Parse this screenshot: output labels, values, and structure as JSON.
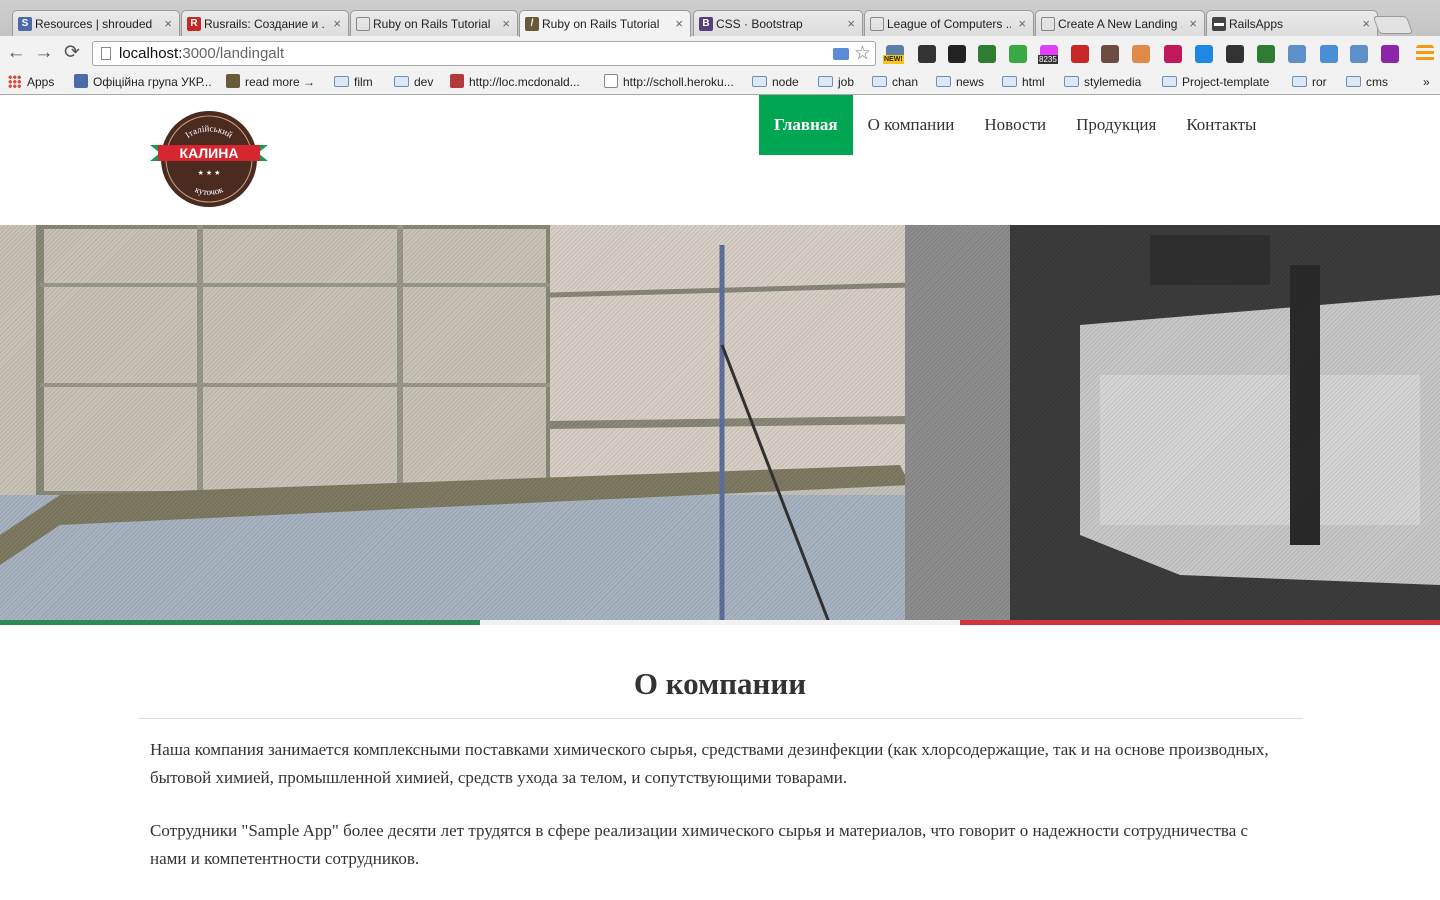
{
  "browser": {
    "tabs": [
      {
        "label": "Resources | shrouded",
        "fav_color": "#4a6aa8",
        "fav_char": "S"
      },
      {
        "label": "Rusrails: Создание и ...",
        "fav_color": "#c62828",
        "fav_char": "R"
      },
      {
        "label": "Ruby on Rails Tutorial",
        "fav_color": "#ffffff",
        "fav_char": ""
      },
      {
        "label": "Ruby on Rails Tutorial",
        "fav_color": "#6b5a3a",
        "fav_char": "/"
      },
      {
        "label": "CSS · Bootstrap",
        "fav_color": "#563d7c",
        "fav_char": "B"
      },
      {
        "label": "League of Computers ...",
        "fav_color": "#ffffff",
        "fav_char": ""
      },
      {
        "label": "Create A New Landing ...",
        "fav_color": "#ffffff",
        "fav_char": ""
      },
      {
        "label": "RailsApps",
        "fav_color": "#444444",
        "fav_char": "▬"
      }
    ],
    "close_glyph": "×",
    "address": {
      "host": "localhost:",
      "path": "3000/landingalt"
    },
    "nav_icons": {
      "back": "←",
      "forward": "→",
      "reload": "⟳",
      "star": "☆"
    },
    "bookmarks": [
      {
        "label": "Apps",
        "type": "apps"
      },
      {
        "label": "Офіційна група УКР...",
        "type": "site",
        "color": "#4a6aa8"
      },
      {
        "label": "read more →",
        "type": "site",
        "color": "#6b5a3a"
      },
      {
        "label": "film",
        "type": "folder"
      },
      {
        "label": "dev",
        "type": "folder"
      },
      {
        "label": "http://loc.mcdonald...",
        "type": "site",
        "color": "#b23a3a"
      },
      {
        "label": "http://scholl.heroku...",
        "type": "page"
      },
      {
        "label": "node",
        "type": "folder"
      },
      {
        "label": "job",
        "type": "folder"
      },
      {
        "label": "chan",
        "type": "folder"
      },
      {
        "label": "news",
        "type": "folder"
      },
      {
        "label": "html",
        "type": "folder"
      },
      {
        "label": "stylemedia",
        "type": "folder"
      },
      {
        "label": "Project-template",
        "type": "folder"
      },
      {
        "label": "ror",
        "type": "folder"
      },
      {
        "label": "cms",
        "type": "folder"
      }
    ],
    "bookmarks_more": "»",
    "extension_colors": [
      "#5b7fa8",
      "#333333",
      "#222222",
      "#2e7d32",
      "#39a845",
      "#e040fb",
      "#c62828",
      "#6d4c41",
      "#e08a4a",
      "#c2185b",
      "#1e88e5",
      "#333333",
      "#2e7d32",
      "#5d8fc9",
      "#4a8fd6",
      "#5d8fc9",
      "#8e24aa",
      "#f39c12"
    ],
    "extension_names": [
      "mail-ext-icon",
      "ruler-ext-icon",
      "chart-ext-icon",
      "refresh-ext-icon",
      "color-ext-icon",
      "gmail-ext-icon",
      "instagram-ext-icon",
      "lotus-ext-icon",
      "e-ext-icon",
      "translate-ext-icon",
      "gear-ext-icon",
      "bw-ext-icon",
      "window-ext-icon",
      "network-ext-icon",
      "folder-ext-icon",
      "resize-ext-icon",
      "menu-icon"
    ],
    "gmail_badge": "8235",
    "new_badge": "NEW!"
  },
  "site": {
    "logo": {
      "top_text": "Італійський",
      "main_text": "КАЛИНА",
      "bottom_text": "куточок"
    },
    "nav": [
      {
        "label": "Главная",
        "active": true
      },
      {
        "label": "О компании",
        "active": false
      },
      {
        "label": "Новости",
        "active": false
      },
      {
        "label": "Продукция",
        "active": false
      },
      {
        "label": "Контакты",
        "active": false
      }
    ],
    "flag_colors": [
      "#2e8b57",
      "#f2f2f2",
      "#d13438"
    ],
    "about": {
      "title": "О компании",
      "paragraphs": [
        "Наша компания занимается комплексными поставками химического сырья, средствами дезинфекции (как хлорсодержащие, так и на основе производных, бытовой химией, промышленной химией, средств ухода за телом, и сопутствующими товарами.",
        "Сотрудники \"Sample App\" более десяти лет трудятся в сфере реализации химического сырья и материалов, что говорит о надежности сотрудничества с нами и компетентности сотрудников."
      ]
    },
    "colors": {
      "accent": "#00a651",
      "text": "#333333"
    }
  }
}
